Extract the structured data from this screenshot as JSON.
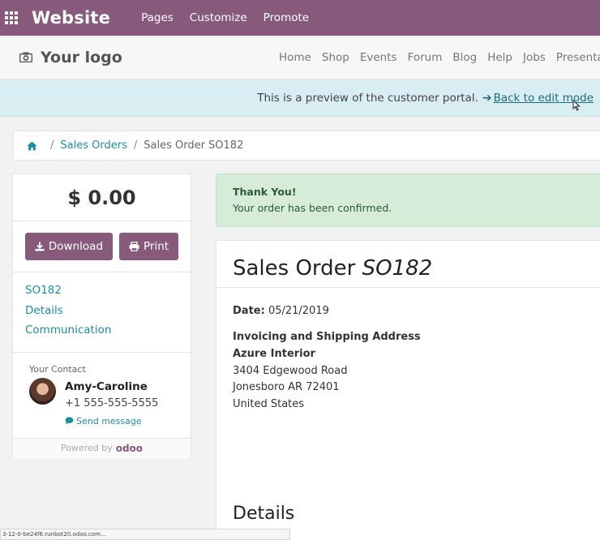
{
  "topbar": {
    "brand": "Website",
    "menu": [
      "Pages",
      "Customize",
      "Promote"
    ]
  },
  "header": {
    "logo_text": "Your logo",
    "nav": [
      "Home",
      "Shop",
      "Events",
      "Forum",
      "Blog",
      "Help",
      "Jobs",
      "Presenta"
    ]
  },
  "preview": {
    "text": "This is a preview of the customer portal.",
    "arrow": "➔",
    "link": "Back to edit mode"
  },
  "breadcrumb": {
    "items": [
      "Sales Orders",
      "Sales Order SO182"
    ]
  },
  "sidebar": {
    "amount": "$ 0.00",
    "download_label": "Download",
    "print_label": "Print",
    "toc": [
      "SO182",
      "Details",
      "Communication"
    ],
    "contact": {
      "label": "Your Contact",
      "name": "Amy-Caroline",
      "phone": "+1 555-555-5555",
      "send": "Send message"
    },
    "powered_by": "Powered by",
    "odoo": "odoo"
  },
  "alert": {
    "title": "Thank You!",
    "message": "Your order has been confirmed."
  },
  "order": {
    "title_prefix": "Sales Order",
    "number": "SO182",
    "date_label": "Date:",
    "date": "05/21/2019",
    "address_title": "Invoicing and Shipping Address",
    "company": "Azure Interior",
    "address_lines": [
      "3404 Edgewood Road",
      "Jonesboro AR 72401",
      "United States"
    ],
    "details_heading": "Details"
  },
  "status_url": "3-12-0-be24f6.runbot20.odoo.com...",
  "colors": {
    "brand": "#875a7b",
    "link": "#1d8ea0",
    "preview_bg": "#d9eef2",
    "success_bg": "#d6ecd9"
  }
}
